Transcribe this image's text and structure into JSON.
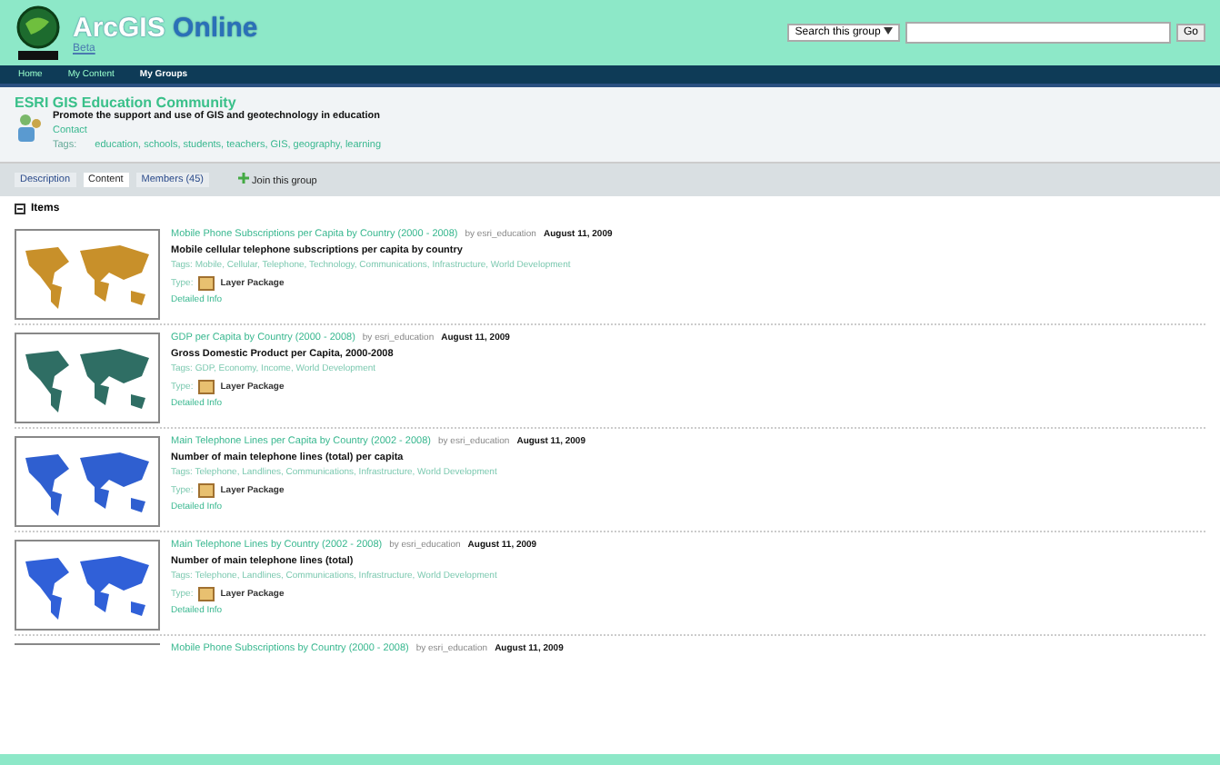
{
  "header": {
    "logo_text": "ArcGIS",
    "logo_suffix": "Online",
    "badge": "Beta",
    "search": {
      "scope": "Search this group",
      "button": "Go"
    }
  },
  "nav": [
    {
      "label": "Home",
      "selected": false
    },
    {
      "label": "My Content",
      "selected": false
    },
    {
      "label": "My Groups",
      "selected": true
    }
  ],
  "group": {
    "title": "ESRI GIS Education Community",
    "summary": "Promote the support and use of GIS and geotechnology in education",
    "contact": "Contact",
    "tags_label": "Tags:",
    "tags": "education, schools, students, teachers, GIS, geography, learning"
  },
  "tabs": [
    {
      "label": "Description",
      "selected": false
    },
    {
      "label": "Content",
      "selected": true
    },
    {
      "label": "Members (45)",
      "selected": false
    }
  ],
  "join": "Join this group",
  "items_heading": "Items",
  "items": [
    {
      "title": "Mobile Phone Subscriptions per Capita by Country (2000 - 2008)",
      "by": "by esri_education",
      "date": "August 11, 2009",
      "description": "Mobile cellular telephone subscriptions per capita by country",
      "tags": "Tags: Mobile, Cellular, Telephone, Technology, Communications, Infrastructure, World Development",
      "type_label": "Type:",
      "type": "Layer Package",
      "details": "Detailed Info"
    },
    {
      "title": "GDP per Capita by Country (2000 - 2008)",
      "by": "by esri_education",
      "date": "August 11, 2009",
      "description": "Gross Domestic Product per Capita, 2000-2008",
      "tags": "Tags: GDP, Economy, Income, World Development",
      "type_label": "Type:",
      "type": "Layer Package",
      "details": "Detailed Info"
    },
    {
      "title": "Main Telephone Lines per Capita by Country (2002 - 2008)",
      "by": "by esri_education",
      "date": "August 11, 2009",
      "description": "Number of main telephone lines (total) per capita",
      "tags": "Tags: Telephone, Landlines, Communications, Infrastructure, World Development",
      "type_label": "Type:",
      "type": "Layer Package",
      "details": "Detailed Info"
    },
    {
      "title": "Main Telephone Lines by Country (2002 - 2008)",
      "by": "by esri_education",
      "date": "August 11, 2009",
      "description": "Number of main telephone lines (total)",
      "tags": "Tags: Telephone, Landlines, Communications, Infrastructure, World Development",
      "type_label": "Type:",
      "type": "Layer Package",
      "details": "Detailed Info"
    }
  ],
  "partial_item": {
    "title": "Mobile Phone Subscriptions by Country (2000 - 2008)",
    "by": "by esri_education",
    "date": "August 11, 2009"
  }
}
